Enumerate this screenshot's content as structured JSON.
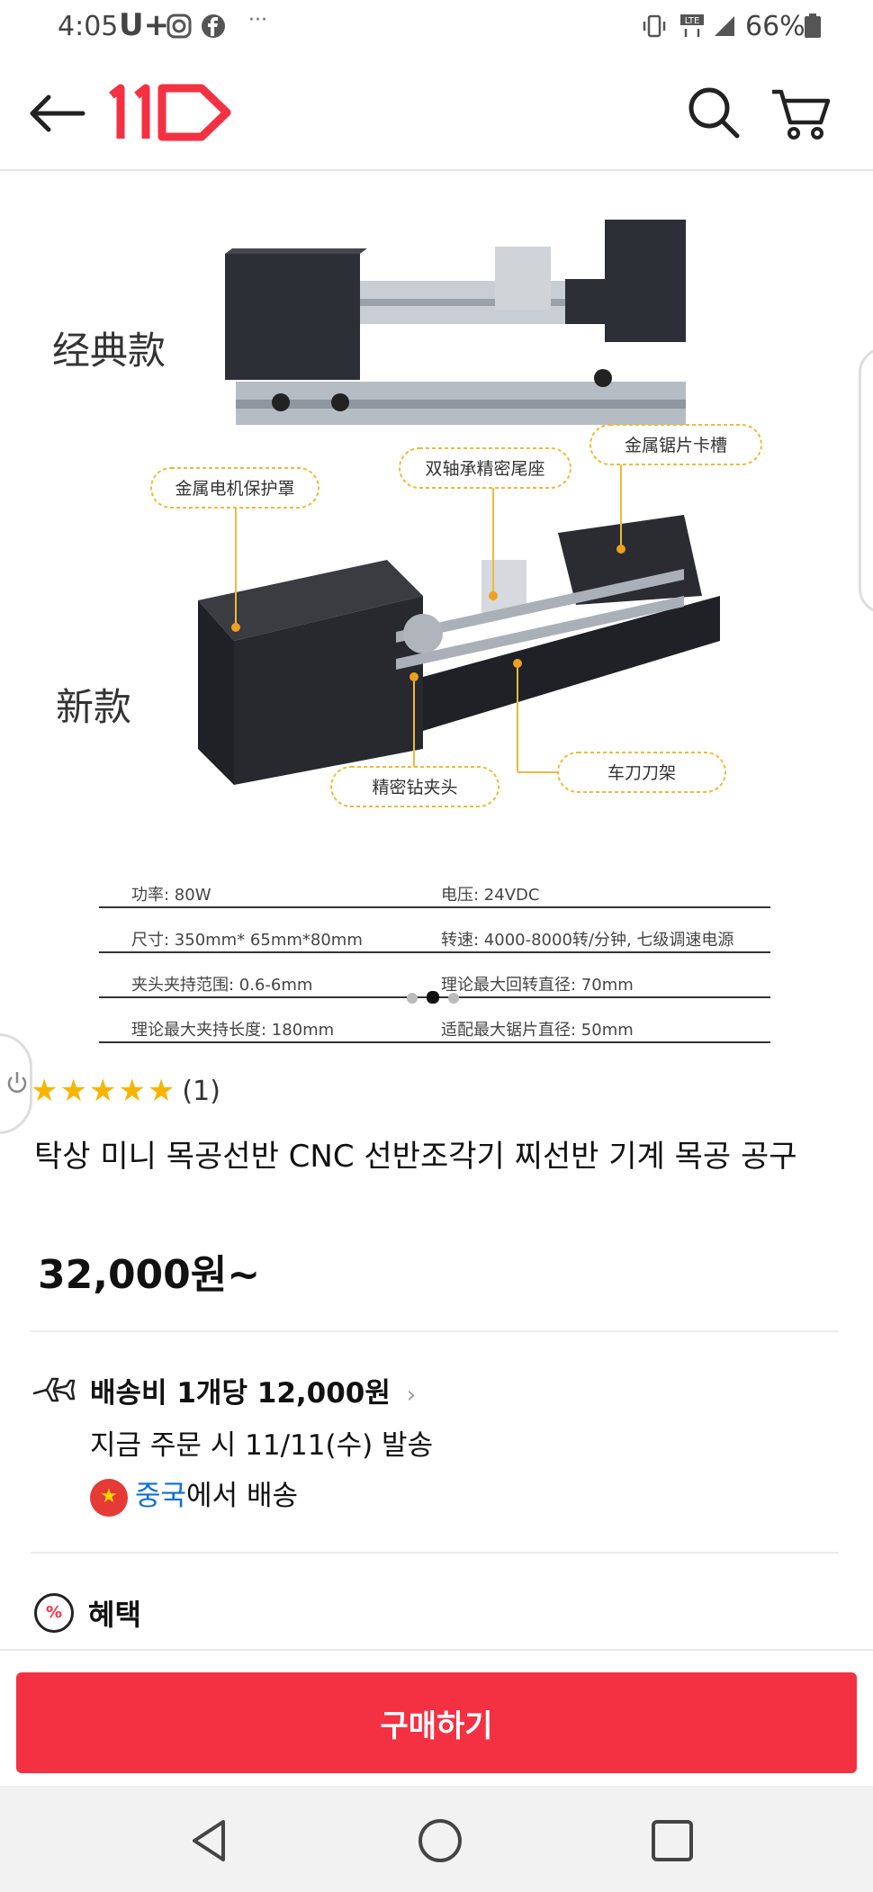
{
  "status_bar": {
    "time": "4:05",
    "carrier": "U+",
    "battery_percent": "66%"
  },
  "header": {
    "logo_text": "11",
    "back_icon": "arrow-left-icon",
    "search_icon": "search-icon",
    "cart_icon": "cart-icon",
    "brand_color": "#f43142"
  },
  "gallery": {
    "labels": {
      "classic": "经典款",
      "new": "新款",
      "motor_cover": "金属电机保护罩",
      "tailstock": "双轴承精密尾座",
      "saw_slot": "金属锯片卡槽",
      "chuck": "精密钻夹头",
      "tool_rest": "车刀刀架"
    },
    "specs": [
      [
        "功率: 80W",
        "电压: 24VDC"
      ],
      [
        "尺寸: 350mm* 65mm*80mm",
        "转速: 4000-8000转/分钟, 七级调速电源"
      ],
      [
        "夹头夹持范围: 0.6-6mm",
        "理论最大回转直径: 70mm"
      ],
      [
        "理论最大夹持长度: 180mm",
        "适配最大锯片直径: 50mm"
      ]
    ],
    "slide_count": 3,
    "active_slide": 2
  },
  "product": {
    "rating_stars": "★★★★★",
    "review_count": "(1)",
    "title": "탁상 미니 목공선반 CNC 선반조각기 찌선반 기계 목공 공구",
    "price": "32,000원~"
  },
  "shipping": {
    "fee_label": "배송비 1개당 12,000원",
    "dispatch": "지금 주문 시 11/11(수) 발송",
    "origin_country": "중국",
    "origin_suffix": "에서 배송"
  },
  "benefit": {
    "label": "혜택",
    "icon_text": "%"
  },
  "buy": {
    "label": "구매하기"
  }
}
